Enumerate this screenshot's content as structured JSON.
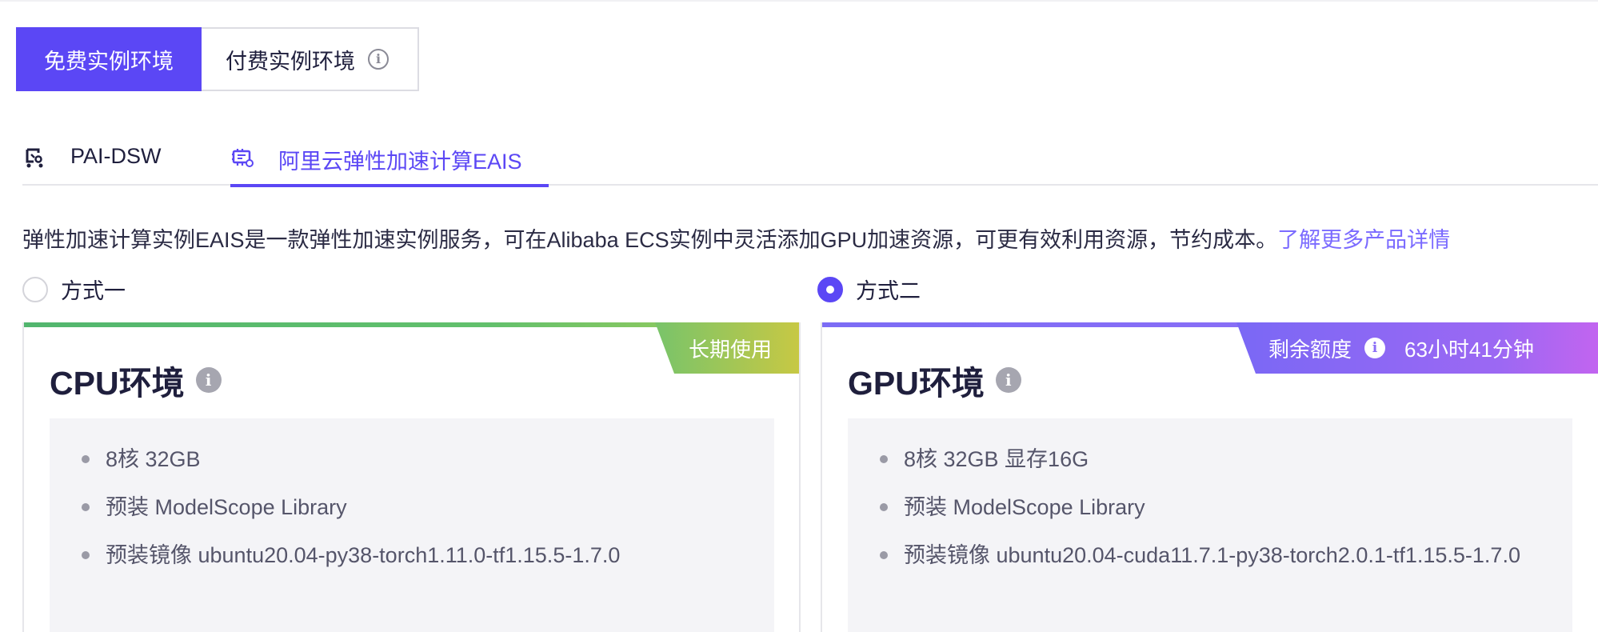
{
  "env_tabs": {
    "free_label": "免费实例环境",
    "paid_label": "付费实例环境"
  },
  "product_tabs": [
    {
      "label": "PAI-DSW",
      "icon": "dsw-icon",
      "active": false
    },
    {
      "label": "阿里云弹性加速计算EAIS",
      "icon": "eais-icon",
      "active": true
    }
  ],
  "description": {
    "text": "弹性加速计算实例EAIS是一款弹性加速实例服务，可在Alibaba ECS实例中灵活添加GPU加速资源，可更有效利用资源，节约成本。",
    "link": "了解更多产品详情"
  },
  "options": [
    {
      "label": "方式一",
      "checked": false
    },
    {
      "label": "方式二",
      "checked": true
    }
  ],
  "cards": {
    "cpu": {
      "title": "CPU环境",
      "badge": "长期使用",
      "specs": [
        "8核 32GB",
        "预装 ModelScope Library",
        "预装镜像 ubuntu20.04-py38-torch1.11.0-tf1.15.5-1.7.0"
      ]
    },
    "gpu": {
      "title": "GPU环境",
      "badge_label": "剩余额度",
      "badge_value": "63小时41分钟",
      "specs": [
        "8核 32GB 显存16G",
        "预装 ModelScope Library",
        "预装镜像 ubuntu20.04-cuda11.7.1-py38-torch2.0.1-tf1.15.5-1.7.0"
      ]
    }
  },
  "colors": {
    "accent": "#5b47f5",
    "link": "#7b6bff",
    "cpu_gradient_start": "#52b66e",
    "gpu_gradient_start": "#7c6cf5"
  }
}
